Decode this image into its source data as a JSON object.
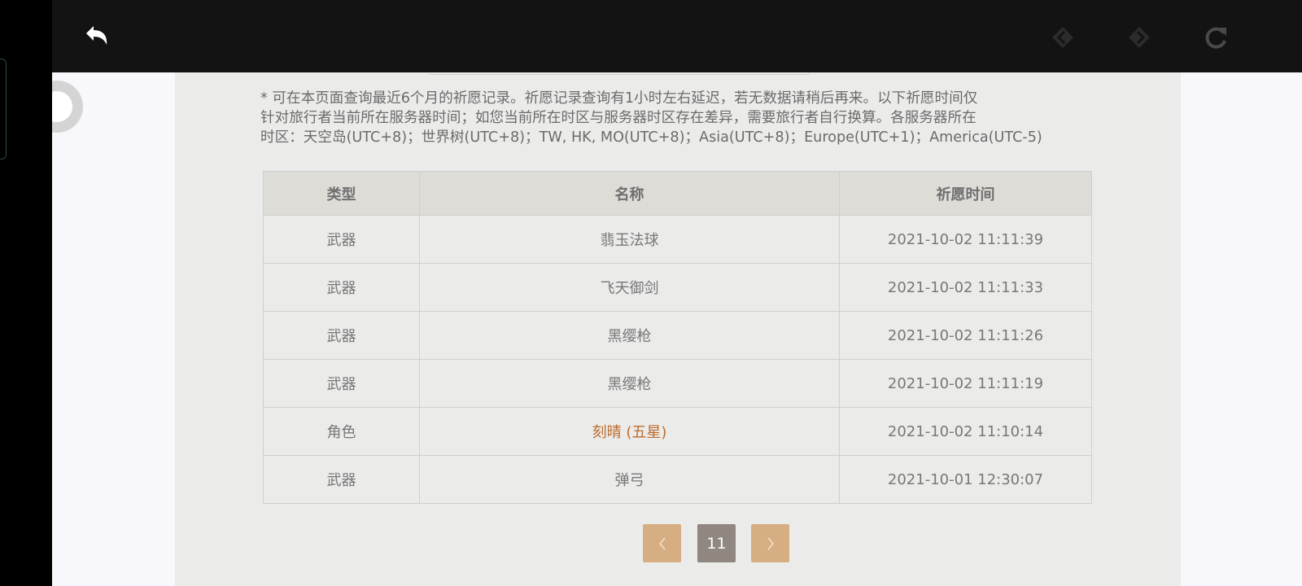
{
  "topbar": {
    "back_icon": "undo-arrow-icon",
    "prev_icon": "diamond-arrow-left-icon",
    "next_icon": "diamond-arrow-right-icon",
    "refresh_icon": "refresh-icon"
  },
  "notice": "* 可在本页面查询最近6个月的祈愿记录。祈愿记录查询有1小时左右延迟，若无数据请稍后再来。以下祈愿时间仅\n针对旅行者当前所在服务器时间；如您当前所在时区与服务器时区存在差异，需要旅行者自行换算。各服务器所在\n时区：天空岛(UTC+8)；世界树(UTC+8)；TW, HK, MO(UTC+8)；Asia(UTC+8)；Europe(UTC+1)；America(UTC-5)",
  "table": {
    "headers": [
      "类型",
      "名称",
      "祈愿时间"
    ],
    "rows": [
      {
        "type": "武器",
        "name": "翡玉法球",
        "time": "2021-10-02 11:11:39"
      },
      {
        "type": "武器",
        "name": "飞天御剑",
        "time": "2021-10-02 11:11:33"
      },
      {
        "type": "武器",
        "name": "黑缨枪",
        "time": "2021-10-02 11:11:26"
      },
      {
        "type": "武器",
        "name": "黑缨枪",
        "time": "2021-10-02 11:11:19"
      },
      {
        "type": "角色",
        "name": "刻晴 (五星)",
        "time": "2021-10-02 11:10:14"
      },
      {
        "type": "武器",
        "name": "弹弓",
        "time": "2021-10-01 12:30:07"
      }
    ]
  },
  "pagination": {
    "current_page": "11",
    "prev_icon": "chevron-left-icon",
    "next_icon": "chevron-right-icon"
  },
  "colors": {
    "five_star": "#bd6c2d",
    "pager_nav": "#d6ae82",
    "pager_current": "#8f8780"
  }
}
